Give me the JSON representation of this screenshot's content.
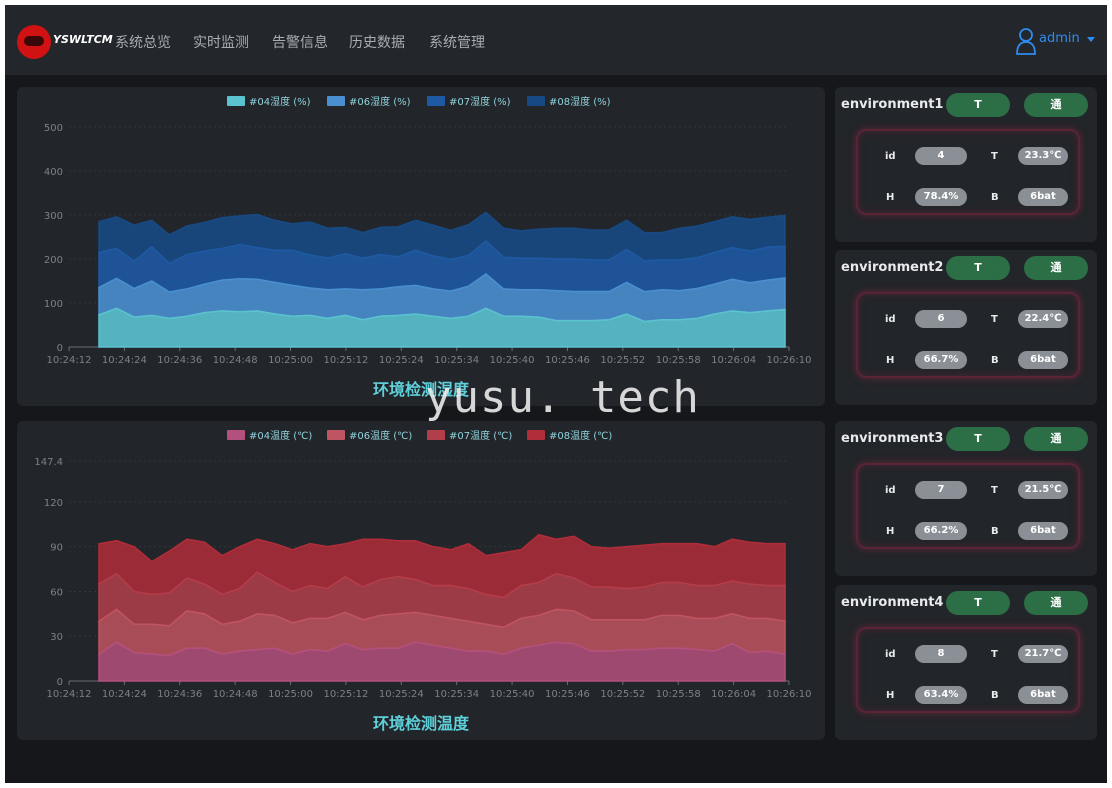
{
  "header": {
    "logo_text": "YSWLTCM",
    "nav": [
      "系统总览",
      "实时监测",
      "告警信息",
      "历史数据",
      "系统管理"
    ],
    "user": "admin"
  },
  "colors": {
    "humidity": [
      "#5bc3cf",
      "#4a8fd0",
      "#1e5aa3",
      "#174a84"
    ],
    "temperature": [
      "#b4507d",
      "#bf5560",
      "#b23e4a",
      "#b02d39"
    ],
    "pill_green": "#2c6e45"
  },
  "chart_data": [
    {
      "type": "area",
      "stacked": true,
      "title": "环境检测湿度",
      "legend": [
        "#04湿度 (%)",
        "#06湿度 (%)",
        "#07湿度 (%)",
        "#08湿度 (%)"
      ],
      "legend_position": "top-center",
      "ylim": [
        0,
        500
      ],
      "yticks": [
        "0",
        "100",
        "200",
        "300",
        "400",
        "500"
      ],
      "xticks": [
        "10:24:12",
        "10:24:24",
        "10:24:36",
        "10:24:48",
        "10:25:00",
        "10:25:12",
        "10:25:24",
        "10:25:34",
        "10:25:40",
        "10:25:46",
        "10:25:52",
        "10:25:58",
        "10:26:04",
        "10:26:10"
      ],
      "grid": true,
      "series": [
        {
          "name": "#04湿度 (%)",
          "values": [
            73,
            88,
            68,
            72,
            65,
            70,
            78,
            82,
            80,
            82,
            75,
            70,
            72,
            65,
            72,
            62,
            70,
            72,
            75,
            70,
            65,
            70,
            88,
            70,
            70,
            68,
            60,
            60,
            60,
            62,
            75,
            58,
            62,
            62,
            65,
            75,
            82,
            78,
            82,
            85
          ]
        },
        {
          "name": "#06湿度 (%)",
          "values": [
            62,
            68,
            65,
            78,
            60,
            62,
            65,
            70,
            75,
            72,
            72,
            70,
            62,
            65,
            60,
            68,
            62,
            65,
            65,
            62,
            62,
            68,
            78,
            62,
            60,
            62,
            68,
            66,
            66,
            64,
            72,
            68,
            68,
            66,
            68,
            68,
            72,
            68,
            70,
            72
          ]
        },
        {
          "name": "#07湿度 (%)",
          "values": [
            80,
            68,
            62,
            78,
            65,
            78,
            75,
            72,
            78,
            72,
            73,
            80,
            75,
            72,
            80,
            72,
            78,
            68,
            80,
            75,
            72,
            70,
            75,
            72,
            72,
            72,
            72,
            74,
            72,
            72,
            75,
            70,
            68,
            70,
            70,
            72,
            72,
            72,
            75,
            72
          ]
        },
        {
          "name": "#08湿度 (%)",
          "values": [
            70,
            72,
            82,
            60,
            65,
            65,
            65,
            70,
            65,
            75,
            68,
            60,
            75,
            68,
            60,
            58,
            62,
            68,
            68,
            70,
            66,
            70,
            65,
            66,
            62,
            66,
            70,
            70,
            68,
            68,
            66,
            64,
            62,
            72,
            72,
            70,
            70,
            72,
            68,
            70
          ]
        }
      ]
    },
    {
      "type": "area",
      "stacked": true,
      "title": "环境检测温度",
      "legend": [
        "#04温度 (℃)",
        "#06温度 (℃)",
        "#07温度 (℃)",
        "#08温度 (℃)"
      ],
      "legend_position": "top-center",
      "ylim": [
        0,
        147.4
      ],
      "yticks": [
        "0",
        "30",
        "60",
        "90",
        "120",
        "147.4"
      ],
      "xticks": [
        "10:24:12",
        "10:24:24",
        "10:24:36",
        "10:24:48",
        "10:25:00",
        "10:25:12",
        "10:25:24",
        "10:25:34",
        "10:25:40",
        "10:25:46",
        "10:25:52",
        "10:25:58",
        "10:26:04",
        "10:26:10"
      ],
      "grid": true,
      "series": [
        {
          "name": "#04温度 (℃)",
          "values": [
            18,
            26,
            19,
            18,
            17,
            22,
            22,
            18,
            20,
            21,
            22,
            18,
            21,
            20,
            25,
            21,
            22,
            22,
            26,
            24,
            22,
            20,
            20,
            18,
            22,
            24,
            26,
            25,
            20,
            20,
            21,
            21,
            22,
            22,
            21,
            20,
            25,
            19,
            20,
            18
          ]
        },
        {
          "name": "#06温度 (℃)",
          "values": [
            22,
            22,
            19,
            20,
            20,
            25,
            23,
            20,
            20,
            24,
            22,
            21,
            21,
            22,
            21,
            20,
            22,
            23,
            20,
            20,
            20,
            20,
            18,
            18,
            20,
            20,
            22,
            22,
            21,
            21,
            20,
            20,
            22,
            22,
            21,
            22,
            20,
            23,
            22,
            22
          ]
        },
        {
          "name": "#07温度 (℃)",
          "values": [
            25,
            24,
            22,
            20,
            22,
            22,
            20,
            20,
            22,
            28,
            22,
            21,
            22,
            20,
            24,
            22,
            24,
            25,
            22,
            20,
            22,
            22,
            20,
            20,
            22,
            22,
            24,
            22,
            22,
            22,
            21,
            22,
            22,
            22,
            22,
            22,
            22,
            23,
            22,
            24
          ]
        },
        {
          "name": "#08温度 (℃)",
          "values": [
            27,
            22,
            30,
            22,
            28,
            26,
            28,
            26,
            28,
            22,
            26,
            28,
            28,
            28,
            22,
            32,
            27,
            24,
            26,
            26,
            24,
            30,
            26,
            30,
            24,
            32,
            23,
            28,
            27,
            26,
            28,
            28,
            26,
            26,
            28,
            26,
            28,
            28,
            28,
            28
          ]
        }
      ]
    }
  ],
  "environments": [
    {
      "title": "environment1",
      "btn_t": "T",
      "btn_w": "通",
      "id_label": "id",
      "id": "4",
      "t_label": "T",
      "t": "23.3℃",
      "h_label": "H",
      "h": "78.4%",
      "b_label": "B",
      "b": "6bat"
    },
    {
      "title": "environment2",
      "btn_t": "T",
      "btn_w": "通",
      "id_label": "id",
      "id": "6",
      "t_label": "T",
      "t": "22.4℃",
      "h_label": "H",
      "h": "66.7%",
      "b_label": "B",
      "b": "6bat"
    },
    {
      "title": "environment3",
      "btn_t": "T",
      "btn_w": "通",
      "id_label": "id",
      "id": "7",
      "t_label": "T",
      "t": "21.5℃",
      "h_label": "H",
      "h": "66.2%",
      "b_label": "B",
      "b": "6bat"
    },
    {
      "title": "environment4",
      "btn_t": "T",
      "btn_w": "通",
      "id_label": "id",
      "id": "8",
      "t_label": "T",
      "t": "21.7℃",
      "h_label": "H",
      "h": "63.4%",
      "b_label": "B",
      "b": "6bat"
    }
  ],
  "watermark": "yusu. tech"
}
